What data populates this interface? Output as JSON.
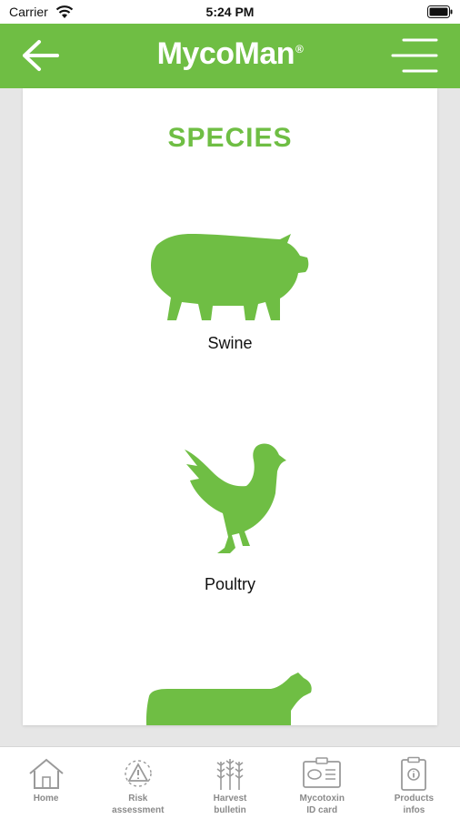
{
  "status_bar": {
    "carrier": "Carrier",
    "time": "5:24 PM",
    "icons": [
      "wifi-icon",
      "battery-icon"
    ]
  },
  "header": {
    "title": "MycoMan",
    "title_mark": "®",
    "back_icon": "arrow-left-icon",
    "menu_icon": "hamburger-menu-icon",
    "color": "#6fbe44"
  },
  "main": {
    "heading": "SPECIES",
    "species": [
      {
        "label": "Swine",
        "icon": "pig-icon"
      },
      {
        "label": "Poultry",
        "icon": "chicken-icon"
      },
      {
        "label": "",
        "icon": "cow-icon"
      }
    ]
  },
  "tab_bar": {
    "tabs": [
      {
        "label": "Home",
        "icon": "home-icon"
      },
      {
        "label": "Risk\nassessment",
        "icon": "risk-warning-icon"
      },
      {
        "label": "Harvest\nbulletin",
        "icon": "wheat-icon"
      },
      {
        "label": "Mycotoxin\nID card",
        "icon": "id-card-icon"
      },
      {
        "label": "Products\ninfos",
        "icon": "clipboard-info-icon"
      }
    ]
  },
  "colors": {
    "accent": "#6fbe44",
    "background": "#e6e6e6",
    "tab_text": "#8a8a8a"
  }
}
